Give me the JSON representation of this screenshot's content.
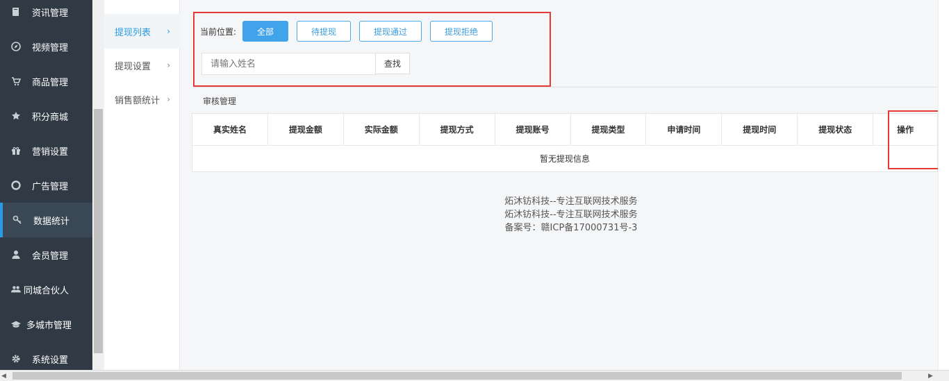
{
  "sidebar": {
    "items": [
      {
        "label": "资讯管理",
        "icon": "book-icon"
      },
      {
        "label": "视频管理",
        "icon": "compass-icon"
      },
      {
        "label": "商品管理",
        "icon": "cart-icon"
      },
      {
        "label": "积分商城",
        "icon": "star-icon"
      },
      {
        "label": "营销设置",
        "icon": "gift-icon"
      },
      {
        "label": "广告管理",
        "icon": "lifebuoy-icon"
      },
      {
        "label": "数据统计",
        "icon": "key-icon"
      },
      {
        "label": "会员管理",
        "icon": "user-icon"
      },
      {
        "label": "同城合伙人",
        "icon": "users-icon"
      },
      {
        "label": "多城市管理",
        "icon": "graduation-cap-icon"
      },
      {
        "label": "系统设置",
        "icon": "gear-icon"
      }
    ],
    "active_index": 6
  },
  "submenu": {
    "items": [
      {
        "label": "提现列表"
      },
      {
        "label": "提现设置"
      },
      {
        "label": "销售额统计"
      }
    ],
    "arrow": "›"
  },
  "filters": {
    "crumb_label": "当前位置:",
    "buttons": [
      "全部",
      "待提现",
      "提现通过",
      "提现拒绝"
    ],
    "search_placeholder": "请输入姓名",
    "search_button": "查找"
  },
  "section": {
    "title": "审核管理"
  },
  "table": {
    "columns": [
      "真实姓名",
      "提现金额",
      "实际金额",
      "提现方式",
      "提现账号",
      "提现类型",
      "申请时间",
      "提现时间",
      "提现状态",
      "操作"
    ],
    "empty_text": "暂无提现信息"
  },
  "footer": {
    "lines": [
      "炻沐钫科技--专注互联网技术服务",
      "炻沐钫科技--专注互联网技术服务",
      "备案号：赣ICP备17000731号-3"
    ]
  },
  "colors": {
    "sidebar_bg": "#2f3a45",
    "accent": "#41a3ea",
    "highlight_red": "#e53935"
  }
}
